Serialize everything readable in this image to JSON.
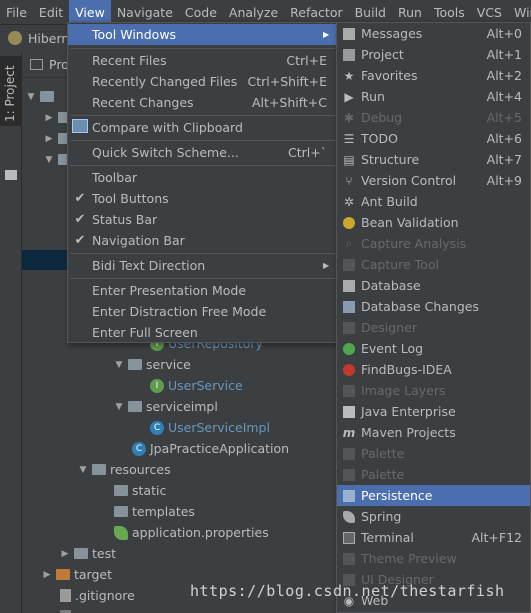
{
  "menubar": {
    "items": [
      "File",
      "Edit",
      "View",
      "Navigate",
      "Code",
      "Analyze",
      "Refactor",
      "Build",
      "Run",
      "Tools",
      "VCS",
      "Windo"
    ],
    "active_index": 2
  },
  "navbar": {
    "project_label": "Hibern"
  },
  "tool_stripe": {
    "project_tab_label": "1: Project"
  },
  "panel": {
    "header_label": "Pro",
    "rows": [
      {
        "label": "UserRepository",
        "style": "link"
      },
      {
        "label": "service"
      },
      {
        "label": "UserService",
        "style": "link"
      },
      {
        "label": "serviceimpl"
      },
      {
        "label": "UserServiceImpl",
        "style": "link"
      },
      {
        "label": "JpaPracticeApplication"
      },
      {
        "label": "resources"
      },
      {
        "label": "static"
      },
      {
        "label": "templates"
      },
      {
        "label": "application.properties"
      },
      {
        "label": "test"
      },
      {
        "label": "target"
      },
      {
        "label": ".gitignore"
      }
    ]
  },
  "view_menu": {
    "items": [
      {
        "label": "Tool Windows",
        "shortcut": "",
        "submenu": true,
        "highlighted": true
      },
      {
        "label": "Recent Files",
        "shortcut": "Ctrl+E"
      },
      {
        "label": "Recently Changed Files",
        "shortcut": "Ctrl+Shift+E"
      },
      {
        "label": "Recent Changes",
        "shortcut": "Alt+Shift+C"
      },
      {
        "label": "Compare with Clipboard",
        "shortcut": ""
      },
      {
        "label": "Quick Switch Scheme...",
        "shortcut": "Ctrl+`"
      },
      {
        "label": "Toolbar",
        "checked": false
      },
      {
        "label": "Tool Buttons",
        "checked": true
      },
      {
        "label": "Status Bar",
        "checked": true
      },
      {
        "label": "Navigation Bar",
        "checked": true
      },
      {
        "label": "Bidi Text Direction",
        "submenu": true
      },
      {
        "label": "Enter Presentation Mode"
      },
      {
        "label": "Enter Distraction Free Mode"
      },
      {
        "label": "Enter Full Screen"
      }
    ]
  },
  "tool_windows_menu": {
    "items": [
      {
        "label": "Messages",
        "shortcut": "Alt+0",
        "icon": "messages-icon"
      },
      {
        "label": "Project",
        "shortcut": "Alt+1",
        "icon": "project-icon"
      },
      {
        "label": "Favorites",
        "shortcut": "Alt+2",
        "icon": "star-icon"
      },
      {
        "label": "Run",
        "shortcut": "Alt+4",
        "icon": "run-icon"
      },
      {
        "label": "Debug",
        "shortcut": "Alt+5",
        "icon": "debug-icon",
        "disabled": true
      },
      {
        "label": "TODO",
        "shortcut": "Alt+6",
        "icon": "todo-icon"
      },
      {
        "label": "Structure",
        "shortcut": "Alt+7",
        "icon": "structure-icon"
      },
      {
        "label": "Version Control",
        "shortcut": "Alt+9",
        "icon": "vcs-icon"
      },
      {
        "label": "Ant Build",
        "shortcut": "",
        "icon": "ant-icon"
      },
      {
        "label": "Bean Validation",
        "shortcut": "",
        "icon": "bean-validation-icon"
      },
      {
        "label": "Capture Analysis",
        "shortcut": "",
        "icon": "capture-analysis-icon",
        "disabled": true
      },
      {
        "label": "Capture Tool",
        "shortcut": "",
        "icon": "capture-tool-icon",
        "disabled": true
      },
      {
        "label": "Database",
        "shortcut": "",
        "icon": "database-icon"
      },
      {
        "label": "Database Changes",
        "shortcut": "",
        "icon": "database-changes-icon"
      },
      {
        "label": "Designer",
        "shortcut": "",
        "icon": "designer-icon",
        "disabled": true
      },
      {
        "label": "Event Log",
        "shortcut": "",
        "icon": "event-log-icon"
      },
      {
        "label": "FindBugs-IDEA",
        "shortcut": "",
        "icon": "findbugs-icon"
      },
      {
        "label": "Image Layers",
        "shortcut": "",
        "icon": "image-layers-icon",
        "disabled": true
      },
      {
        "label": "Java Enterprise",
        "shortcut": "",
        "icon": "java-enterprise-icon"
      },
      {
        "label": "Maven Projects",
        "shortcut": "",
        "icon": "maven-icon"
      },
      {
        "label": "Palette",
        "shortcut": "",
        "icon": "palette-icon",
        "disabled": true
      },
      {
        "label": "Palette",
        "shortcut": "",
        "icon": "palette-icon",
        "disabled": true
      },
      {
        "label": "Persistence",
        "shortcut": "",
        "icon": "persistence-icon",
        "highlighted": true
      },
      {
        "label": "Spring",
        "shortcut": "",
        "icon": "spring-icon"
      },
      {
        "label": "Terminal",
        "shortcut": "Alt+F12",
        "icon": "terminal-icon"
      },
      {
        "label": "Theme Preview",
        "shortcut": "",
        "icon": "theme-preview-icon",
        "disabled": true
      },
      {
        "label": "UI Designer",
        "shortcut": "",
        "icon": "ui-designer-icon",
        "disabled": true
      },
      {
        "label": "Web",
        "shortcut": "",
        "icon": "web-icon"
      }
    ]
  },
  "watermark": {
    "text": "https://blog.csdn.net/thestarfish"
  }
}
